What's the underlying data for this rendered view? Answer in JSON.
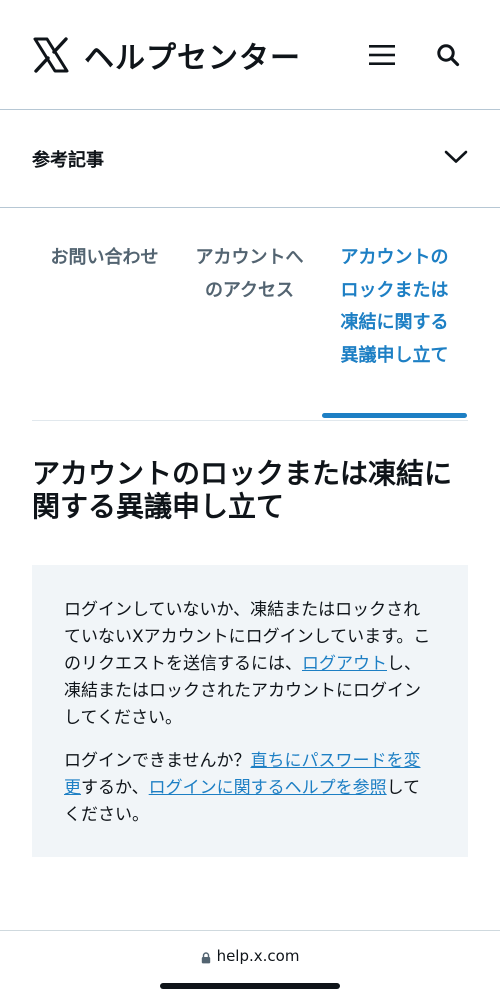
{
  "header": {
    "title": "ヘルプセンター",
    "logo_icon": "x-logo-icon",
    "menu_icon": "hamburger-menu-icon",
    "search_icon": "search-icon"
  },
  "related": {
    "label": "参考記事",
    "icon": "chevron-down-icon"
  },
  "tabs": [
    {
      "label": "お問い合わせ"
    },
    {
      "label": "アカウントへのアクセス"
    },
    {
      "label": "アカウントのロックまたは凍結に関する異議申し立て",
      "active": true
    }
  ],
  "page": {
    "title": "アカウントのロックまたは凍結に関する異議申し立て"
  },
  "notice": {
    "p1_text_a": "ログインしていないか、凍結またはロックされていないXアカウントにログインしています。このリクエストを送信するには、",
    "p1_link": "ログアウト",
    "p1_text_b": "し、凍結またはロックされたアカウントにログインしてください。",
    "p2_text_a": "ログインできませんか？",
    "p2_link_1": "直ちにパスワードを変更",
    "p2_text_b": "するか、",
    "p2_link_2": "ログインに関するヘルプを参照",
    "p2_text_c": "してください。"
  },
  "browser": {
    "url": "help.x.com",
    "lock_icon": "lock-icon"
  },
  "colors": {
    "accent": "#1d7fc4",
    "text": "#0f1419",
    "muted": "#536471",
    "notice_bg": "#f1f5f8"
  }
}
